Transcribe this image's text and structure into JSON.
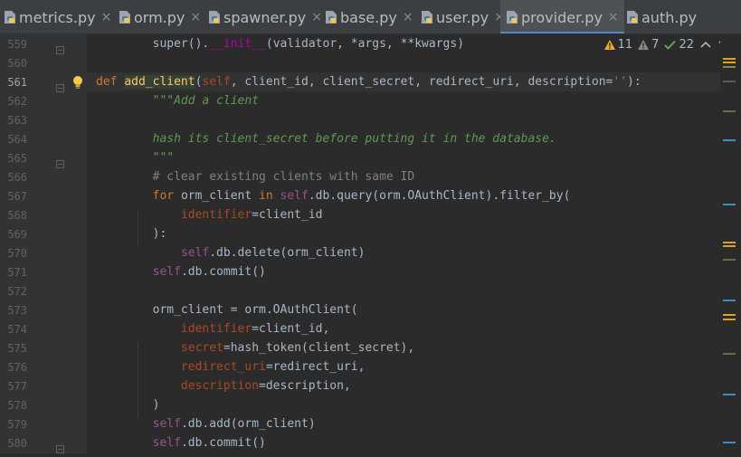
{
  "tabs": [
    {
      "label": "metrics.py",
      "active": false
    },
    {
      "label": "orm.py",
      "active": false
    },
    {
      "label": "spawner.py",
      "active": false
    },
    {
      "label": "base.py",
      "active": false
    },
    {
      "label": "user.py",
      "active": false
    },
    {
      "label": "provider.py",
      "active": true
    },
    {
      "label": "auth.py",
      "active": false
    }
  ],
  "close_glyph": "×",
  "inspections": {
    "warnings": "11",
    "weak_warnings": "7",
    "typos": "22"
  },
  "colors": {
    "keyword": "#cc7832",
    "self": "#94558d",
    "dunder": "#b200b2",
    "function": "#ffc66d",
    "param": "#aa4926",
    "docstring": "#629755",
    "comment": "#808080",
    "string": "#6a8759",
    "text": "#a9b7c6",
    "background": "#2b2b2b",
    "gutter": "#313335",
    "accent": "#4a88c7"
  },
  "lines": [
    {
      "num": "559",
      "tokens": [
        [
          "        ",
          ""
        ],
        [
          "super",
          "t"
        ],
        [
          "().",
          ""
        ],
        [
          "__init__",
          "dnd"
        ],
        [
          "(validator, *args, **kwargs)",
          ""
        ]
      ]
    },
    {
      "num": "560",
      "tokens": []
    },
    {
      "num": "561",
      "current": true,
      "bulb": true,
      "tokens": [
        [
          "def ",
          "kw"
        ],
        [
          "add_client",
          "fn"
        ],
        [
          "(",
          ""
        ],
        [
          "self",
          "prm"
        ],
        [
          ", client_id, client_secret, redirect_uri, description=",
          ""
        ],
        [
          "''",
          "str"
        ],
        [
          "):",
          ""
        ]
      ]
    },
    {
      "num": "562",
      "tokens": [
        [
          "        ",
          ""
        ],
        [
          "\"\"\"Add a client",
          "doc"
        ]
      ]
    },
    {
      "num": "563",
      "tokens": []
    },
    {
      "num": "564",
      "tokens": [
        [
          "        ",
          ""
        ],
        [
          "hash its client_secret before putting it in the database.",
          "doc"
        ]
      ]
    },
    {
      "num": "565",
      "tokens": [
        [
          "        ",
          ""
        ],
        [
          "\"\"\"",
          "doc"
        ]
      ]
    },
    {
      "num": "566",
      "tokens": [
        [
          "        ",
          ""
        ],
        [
          "# clear existing clients with same ID",
          "cmt"
        ]
      ]
    },
    {
      "num": "567",
      "tokens": [
        [
          "        ",
          ""
        ],
        [
          "for ",
          "kw"
        ],
        [
          "orm_client ",
          ""
        ],
        [
          "in ",
          "kw"
        ],
        [
          "self",
          "slf"
        ],
        [
          ".db.query(orm.OAuthClient).filter_by(",
          ""
        ]
      ]
    },
    {
      "num": "568",
      "tokens": [
        [
          "            ",
          ""
        ],
        [
          "identifier",
          "prm"
        ],
        [
          "=client_id",
          ""
        ]
      ]
    },
    {
      "num": "569",
      "tokens": [
        [
          "        ",
          ""
        ],
        [
          "):",
          ""
        ]
      ]
    },
    {
      "num": "570",
      "tokens": [
        [
          "            ",
          ""
        ],
        [
          "self",
          "slf"
        ],
        [
          ".db.delete(orm_client)",
          ""
        ]
      ]
    },
    {
      "num": "571",
      "tokens": [
        [
          "        ",
          ""
        ],
        [
          "self",
          "slf"
        ],
        [
          ".db.commit()",
          ""
        ]
      ]
    },
    {
      "num": "572",
      "tokens": []
    },
    {
      "num": "573",
      "tokens": [
        [
          "        ",
          ""
        ],
        [
          "orm_client = orm.OAuthClient(",
          ""
        ]
      ]
    },
    {
      "num": "574",
      "tokens": [
        [
          "            ",
          ""
        ],
        [
          "identifier",
          "prm"
        ],
        [
          "=client_id,",
          ""
        ]
      ]
    },
    {
      "num": "575",
      "tokens": [
        [
          "            ",
          ""
        ],
        [
          "secret",
          "prm"
        ],
        [
          "=hash_token(client_secret),",
          ""
        ]
      ]
    },
    {
      "num": "576",
      "tokens": [
        [
          "            ",
          ""
        ],
        [
          "redirect_uri",
          "prm"
        ],
        [
          "=redirect_uri,",
          ""
        ]
      ]
    },
    {
      "num": "577",
      "tokens": [
        [
          "            ",
          ""
        ],
        [
          "description",
          "prm"
        ],
        [
          "=description,",
          ""
        ]
      ]
    },
    {
      "num": "578",
      "tokens": [
        [
          "        ",
          ""
        ],
        [
          ")",
          ""
        ]
      ]
    },
    {
      "num": "579",
      "tokens": [
        [
          "        ",
          ""
        ],
        [
          "self",
          "slf"
        ],
        [
          ".db.add(orm_client)",
          ""
        ]
      ]
    },
    {
      "num": "580",
      "tokens": [
        [
          "        ",
          ""
        ],
        [
          "self",
          "slf"
        ],
        [
          ".db.commit()",
          ""
        ]
      ]
    }
  ]
}
